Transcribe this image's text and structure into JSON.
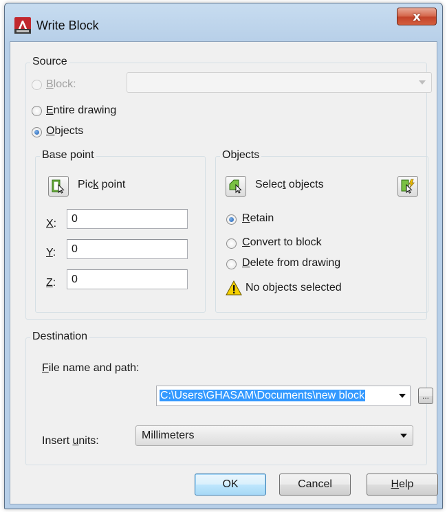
{
  "window": {
    "title": "Write Block",
    "close_glyph": "x"
  },
  "source": {
    "group_title": "Source",
    "block": {
      "label_mnemonic": "B",
      "label_rest": "lock:",
      "enabled": false,
      "value": ""
    },
    "entire_drawing": {
      "label_mnemonic": "E",
      "label_rest": "ntire drawing",
      "checked": false
    },
    "objects": {
      "label_mnemonic": "O",
      "label_rest": "bjects",
      "checked": true
    }
  },
  "base_point": {
    "group_title": "Base point",
    "pick_point": {
      "label_pre": "Pic",
      "label_mnemonic": "k",
      "label_post": " point",
      "icon": "pick-point-icon"
    },
    "x": {
      "label_mnemonic": "X",
      "label_rest": ":",
      "value": "0"
    },
    "y": {
      "label_mnemonic": "Y",
      "label_rest": ":",
      "value": "0"
    },
    "z": {
      "label_mnemonic": "Z",
      "label_rest": ":",
      "value": "0"
    }
  },
  "objects_group": {
    "group_title": "Objects",
    "select_objects": {
      "label_pre": "Selec",
      "label_mnemonic": "t",
      "label_post": " objects",
      "icon": "select-objects-icon"
    },
    "quick_select_icon": "quick-select-icon",
    "retain": {
      "label_mnemonic": "R",
      "label_rest": "etain",
      "checked": true
    },
    "convert": {
      "label_mnemonic": "C",
      "label_rest": "onvert to block",
      "checked": false
    },
    "delete": {
      "label_mnemonic": "D",
      "label_rest": "elete from drawing",
      "checked": false
    },
    "status": {
      "icon": "warning-icon",
      "text": "No objects selected"
    }
  },
  "destination": {
    "group_title": "Destination",
    "file_label_mnemonic": "F",
    "file_label_rest": "ile name and path:",
    "file_path": "C:\\Users\\GHASAM\\Documents\\new block",
    "browse_label": "...",
    "units_label_pre": "Insert ",
    "units_label_mnemonic": "u",
    "units_label_post": "nits:",
    "units_value": "Millimeters"
  },
  "buttons": {
    "ok": "OK",
    "cancel": "Cancel",
    "help_mnemonic": "H",
    "help_rest": "elp"
  },
  "colors": {
    "selection": "#3399ff",
    "warning": "#f5d000",
    "titlebar": "#b9d1ea",
    "close": "#c9462c"
  }
}
